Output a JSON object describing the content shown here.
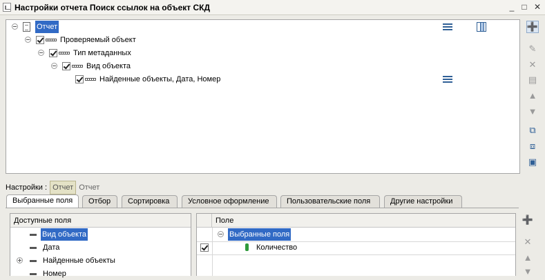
{
  "window": {
    "title": "Настройки отчета  Поиск ссылок на объект СКД",
    "controls": [
      "_",
      "□",
      "✕"
    ]
  },
  "structure_tree": {
    "root": "Отчет",
    "items": [
      {
        "label": "Проверяемый объект",
        "checked": true
      },
      {
        "label": "Тип метаданных",
        "checked": true
      },
      {
        "label": "Вид объекта",
        "checked": true
      },
      {
        "label": "Найденные объекты, Дата, Номер",
        "checked": true
      }
    ]
  },
  "settings_mode": {
    "label": "Настройки :",
    "active": "Отчет",
    "inactive": "Отчет"
  },
  "tabs": [
    {
      "label": "Выбранные поля",
      "active": true
    },
    {
      "label": "Отбор",
      "active": false
    },
    {
      "label": "Сортировка",
      "active": false
    },
    {
      "label": "Условное оформление",
      "active": false
    },
    {
      "label": "Пользовательские поля",
      "active": false
    },
    {
      "label": "Другие настройки",
      "active": false
    }
  ],
  "available_fields": {
    "header": "Доступные поля",
    "items": [
      {
        "label": "Вид объекта",
        "selected": true,
        "expandable": false
      },
      {
        "label": "Дата",
        "selected": false,
        "expandable": false
      },
      {
        "label": "Найденные объекты",
        "selected": false,
        "expandable": true
      },
      {
        "label": "Номер",
        "selected": false,
        "expandable": false
      }
    ]
  },
  "selected_fields": {
    "header": "Поле",
    "group": "Выбранные поля",
    "rows": [
      {
        "label": "Количество",
        "checked": true
      }
    ]
  },
  "colors": {
    "selection": "#316ac5",
    "window_bg": "#ecebe6",
    "active_tool": "#1f7a2a"
  }
}
